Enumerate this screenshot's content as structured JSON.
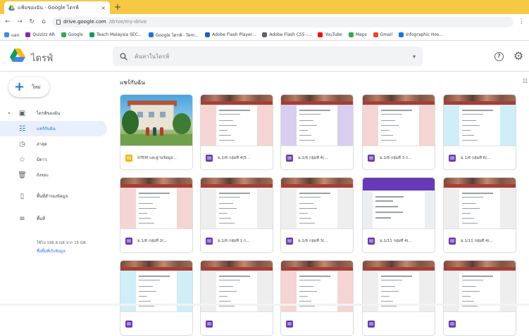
{
  "browser": {
    "tab_title": "แฟ้มของฉัน - Google ไดรฟ์",
    "tab_close": "×",
    "new_tab": "+",
    "url_host": "drive.google.com",
    "url_path": "/drive/my-drive",
    "more": "⋮",
    "bookmarks": [
      {
        "label": "แอป",
        "color": "#4285f4"
      },
      {
        "label": "Quizizz AR",
        "color": "#8e24aa"
      },
      {
        "label": "Google",
        "color": "#34a853"
      },
      {
        "label": "Teach Malaysia SEC...",
        "color": "#0f9d58"
      },
      {
        "label": "Google ไดรฟ์ - Tem...",
        "color": "#1a73e8"
      },
      {
        "label": "Adobe Flash Player...",
        "color": "#1565c0"
      },
      {
        "label": "Adobe Flash CS5 -...",
        "color": "#5f6368"
      },
      {
        "label": "YouTube",
        "color": "#ff0000"
      },
      {
        "label": "Maps",
        "color": "#34a853"
      },
      {
        "label": "Gmail",
        "color": "#ea4335"
      },
      {
        "label": "Infographic Hos...",
        "color": "#1a73e8"
      }
    ]
  },
  "header": {
    "brand": "ไดรฟ์",
    "search_placeholder": "ค้นหาในไดรฟ์",
    "search_caret": "▾",
    "help": "?",
    "settings": "⚙"
  },
  "sidebar": {
    "new_label": "ใหม่",
    "items": [
      {
        "label": "ไดรฟ์ของฉัน",
        "icon": "drive-icon",
        "glyph": "▣",
        "caret": "▸",
        "active": false
      },
      {
        "label": "แชร์กับฉัน",
        "icon": "shared-icon",
        "glyph": "☷",
        "caret": "",
        "active": true
      },
      {
        "label": "ล่าสุด",
        "icon": "clock-icon",
        "glyph": "◷",
        "caret": "",
        "active": false
      },
      {
        "label": "มีดาว",
        "icon": "star-icon",
        "glyph": "☆",
        "caret": "",
        "active": false
      },
      {
        "label": "ถังขยะ",
        "icon": "trash-icon",
        "glyph": "🗑",
        "caret": "",
        "active": false
      },
      {
        "label": "พื้นที่สำรองข้อมูล",
        "icon": "backup-icon",
        "glyph": "▯",
        "caret": "",
        "active": false
      },
      {
        "label": "พื้นที่",
        "icon": "storage-icon",
        "glyph": "≡",
        "caret": "",
        "active": false
      }
    ],
    "storage_used": "ใช้ไป 196.6 GB จาก 15 GB",
    "storage_link": "ซื้อพื้นที่เก็บข้อมูล"
  },
  "main": {
    "section_title": "แชร์กับฉัน",
    "toggle": "☷",
    "files": [
      {
        "name": "STEM และฐานข้อมูล...",
        "type": "slides",
        "thumb": "photo",
        "side": ""
      },
      {
        "name": "ม.1/6 กลุ่มที่ 4(5...",
        "type": "form",
        "thumb": "form",
        "side": "#f4d5d3"
      },
      {
        "name": "ม.1/6 กลุ่มที่ 4(...",
        "type": "form",
        "thumb": "form",
        "side": "#d9cef0"
      },
      {
        "name": "ม.1/6 กลุ่มที่ 3 ก...",
        "type": "form",
        "thumb": "form",
        "side": "#f4d5d3"
      },
      {
        "name": "ม.1/6 กลุ่มที่ 6(...",
        "type": "form",
        "thumb": "form",
        "side": "#cfeef7"
      },
      {
        "name": "ม.1/6 กลุ่มที่ 2(...",
        "type": "form",
        "thumb": "form",
        "side": "#f4d5d3"
      },
      {
        "name": "ม.1/6 กลุ่มที่ 1 ก...",
        "type": "form",
        "thumb": "form",
        "side": "#eeeeee"
      },
      {
        "name": "ม.1/6 กลุ่มที่ 3(...",
        "type": "form",
        "thumb": "form",
        "side": "#eeeeee"
      },
      {
        "name": "ม.1/11 กลุ่มที่ 4(...",
        "type": "form",
        "thumb": "purple",
        "side": ""
      },
      {
        "name": "ม.1/11 กลุ่มที่ 4(...",
        "type": "form",
        "thumb": "form",
        "side": "#eeeeee"
      },
      {
        "name": "",
        "type": "form",
        "thumb": "form",
        "side": "#cfeef7"
      },
      {
        "name": "",
        "type": "form",
        "thumb": "form",
        "side": "#eeeeee"
      },
      {
        "name": "",
        "type": "form",
        "thumb": "form",
        "side": "#f4d5d3"
      },
      {
        "name": "",
        "type": "form",
        "thumb": "form",
        "side": "#eeeeee"
      },
      {
        "name": "",
        "type": "form",
        "thumb": "form",
        "side": "#eeeeee"
      }
    ]
  },
  "colors": {
    "tabstrip": "#f7c843",
    "accent": "#1a73e8",
    "forms_purple": "#673ab7",
    "active_nav": "#e8f0fe"
  }
}
